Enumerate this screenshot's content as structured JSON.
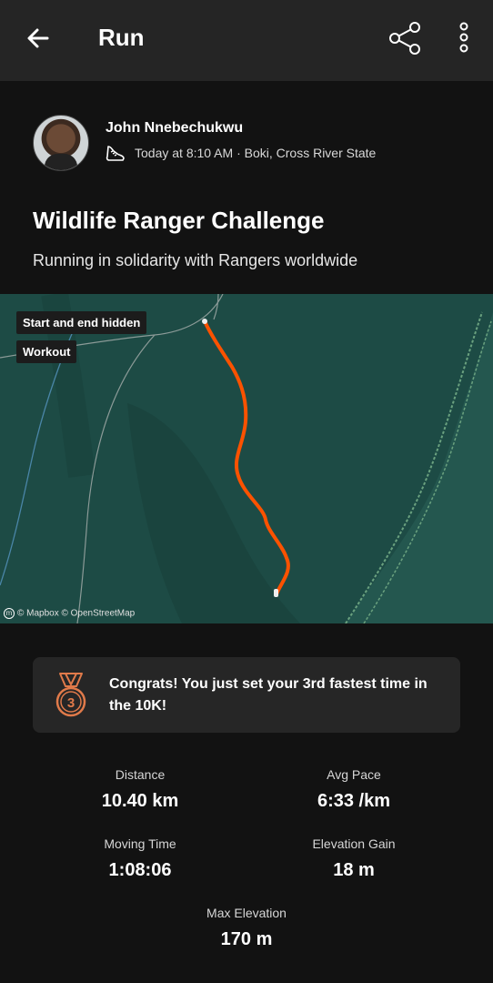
{
  "header": {
    "title": "Run"
  },
  "athlete": {
    "name": "John Nnebechukwu",
    "meta": "Today at 8:10 AM · Boki, Cross River State"
  },
  "activity": {
    "title": "Wildlife Ranger Challenge",
    "description": "Running in solidarity with Rangers worldwide"
  },
  "map": {
    "badge_hidden": "Start and end hidden",
    "badge_workout": "Workout",
    "credit": "© Mapbox © OpenStreetMap",
    "route_color": "#fc5200"
  },
  "achievement": {
    "medal_rank": "3",
    "text": "Congrats! You just set your 3rd fastest time in the 10K!"
  },
  "stats": {
    "distance": {
      "label": "Distance",
      "value": "10.40 km"
    },
    "avg_pace": {
      "label": "Avg Pace",
      "value": "6:33 /km"
    },
    "moving_time": {
      "label": "Moving Time",
      "value": "1:08:06"
    },
    "elevation_gain": {
      "label": "Elevation Gain",
      "value": "18 m"
    },
    "max_elevation": {
      "label": "Max Elevation",
      "value": "170 m"
    }
  }
}
